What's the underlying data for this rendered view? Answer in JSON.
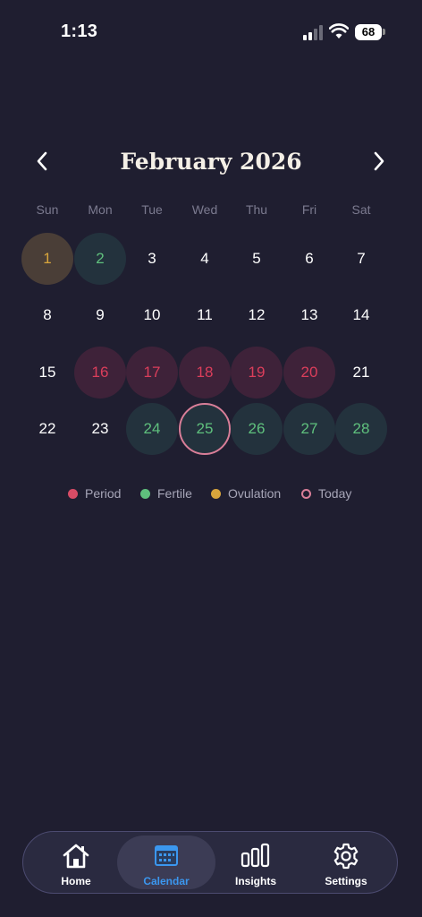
{
  "status_bar": {
    "time": "1:13",
    "battery": "68"
  },
  "calendar": {
    "title": "February 2026",
    "weekdays": [
      "Sun",
      "Mon",
      "Tue",
      "Wed",
      "Thu",
      "Fri",
      "Sat"
    ],
    "days": [
      {
        "n": "1",
        "type": "ovulation"
      },
      {
        "n": "2",
        "type": "fertile"
      },
      {
        "n": "3",
        "type": "normal"
      },
      {
        "n": "4",
        "type": "normal"
      },
      {
        "n": "5",
        "type": "normal"
      },
      {
        "n": "6",
        "type": "normal"
      },
      {
        "n": "7",
        "type": "normal"
      },
      {
        "n": "8",
        "type": "normal"
      },
      {
        "n": "9",
        "type": "normal"
      },
      {
        "n": "10",
        "type": "normal"
      },
      {
        "n": "11",
        "type": "normal"
      },
      {
        "n": "12",
        "type": "normal"
      },
      {
        "n": "13",
        "type": "normal"
      },
      {
        "n": "14",
        "type": "normal"
      },
      {
        "n": "15",
        "type": "normal"
      },
      {
        "n": "16",
        "type": "period"
      },
      {
        "n": "17",
        "type": "period"
      },
      {
        "n": "18",
        "type": "period"
      },
      {
        "n": "19",
        "type": "period"
      },
      {
        "n": "20",
        "type": "period"
      },
      {
        "n": "21",
        "type": "normal"
      },
      {
        "n": "22",
        "type": "normal"
      },
      {
        "n": "23",
        "type": "normal"
      },
      {
        "n": "24",
        "type": "fertile"
      },
      {
        "n": "25",
        "type": "fertile",
        "today": true
      },
      {
        "n": "26",
        "type": "fertile"
      },
      {
        "n": "27",
        "type": "fertile"
      },
      {
        "n": "28",
        "type": "fertile"
      }
    ]
  },
  "legend": [
    {
      "label": "Period",
      "color": "#d84c66",
      "kind": "filled"
    },
    {
      "label": "Fertile",
      "color": "#5fc07d",
      "kind": "filled"
    },
    {
      "label": "Ovulation",
      "color": "#d8a53c",
      "kind": "filled"
    },
    {
      "label": "Today",
      "color": "#d97e98",
      "kind": "ring"
    }
  ],
  "tabs": [
    {
      "label": "Home",
      "icon": "home-icon",
      "active": false
    },
    {
      "label": "Calendar",
      "icon": "calendar-icon",
      "active": true
    },
    {
      "label": "Insights",
      "icon": "bar-chart-icon",
      "active": false
    },
    {
      "label": "Settings",
      "icon": "gear-icon",
      "active": false
    }
  ],
  "colors": {
    "background": "#1f1e30",
    "accent": "#3b97ef",
    "period": "#db3e5b",
    "fertile": "#5fc07d",
    "ovulation": "#d8a53c"
  }
}
